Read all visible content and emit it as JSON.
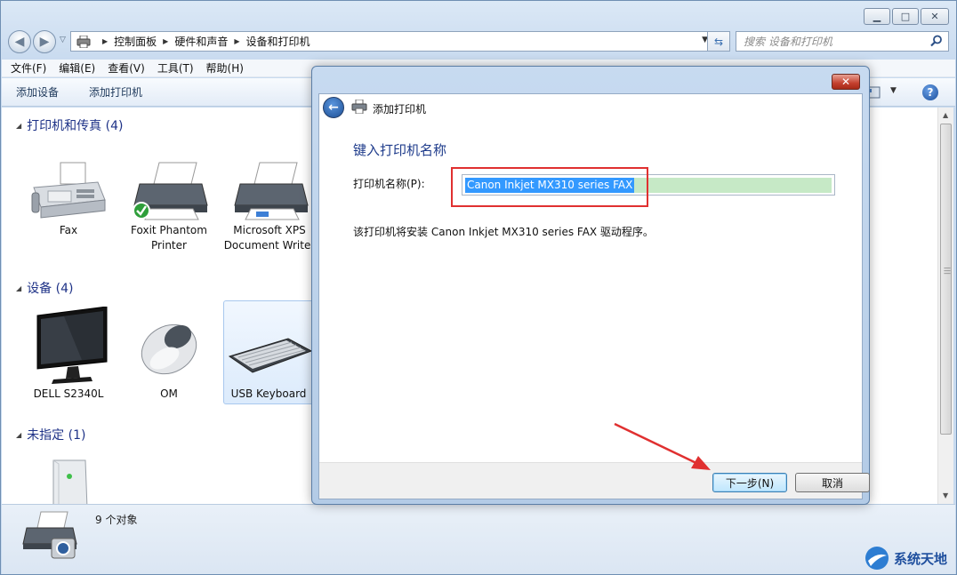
{
  "window": {
    "minimize_glyph": "▁",
    "maximize_glyph": "□",
    "close_glyph": "✕"
  },
  "address": {
    "crumbs": [
      "控制面板",
      "硬件和声音",
      "设备和打印机"
    ]
  },
  "search": {
    "placeholder": "搜索 设备和打印机"
  },
  "menu": [
    "文件(F)",
    "编辑(E)",
    "查看(V)",
    "工具(T)",
    "帮助(H)"
  ],
  "commands": [
    "添加设备",
    "添加打印机"
  ],
  "groups": {
    "printers": {
      "title": "打印机和传真 (4)",
      "items": [
        "Fax",
        "Foxit Phantom Printer",
        "Microsoft XPS Document Writer"
      ]
    },
    "devices": {
      "title": "设备 (4)",
      "items": [
        "DELL S2340L",
        "OM",
        "USB Keyboard"
      ]
    },
    "unspecified": {
      "title": "未指定 (1)"
    }
  },
  "details": {
    "count": "9 个对象"
  },
  "dialog": {
    "title": "添加打印机",
    "heading": "键入打印机名称",
    "label": "打印机名称(P):",
    "printer_name": "Canon Inkjet MX310 series FAX",
    "description": "该打印机将安装 Canon Inkjet MX310 series FAX 驱动程序。",
    "next_button": "下一步(N)",
    "cancel_button": "取消"
  },
  "watermark": "系统天地",
  "colors": {
    "accent": "#1e3287",
    "annotation": "#e03030",
    "selection": "#3399ff"
  }
}
